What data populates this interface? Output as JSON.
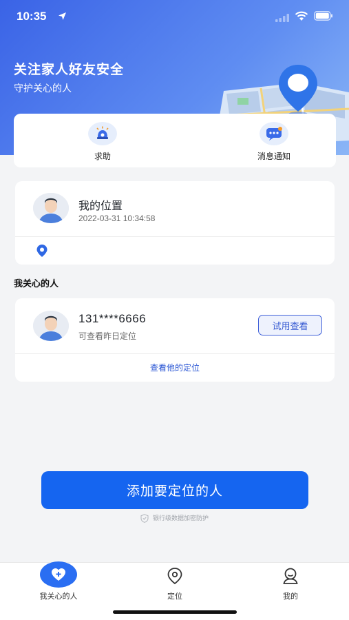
{
  "status_bar": {
    "time": "10:35"
  },
  "hero": {
    "title": "关注家人好友安全",
    "subtitle": "守护关心的人"
  },
  "quick_actions": [
    {
      "label": "求助",
      "icon": "alarm-bell-icon"
    },
    {
      "label": "消息通知",
      "icon": "message-icon"
    }
  ],
  "my_location": {
    "title": "我的位置",
    "timestamp": "2022-03-31 10:34:58",
    "address": ""
  },
  "section_title": "我关心的人",
  "cared_person": {
    "phone": "131****6666",
    "description": "可查看昨日定位",
    "trial_button": "试用查看",
    "view_link": "查看他的定位"
  },
  "primary_button": "添加要定位的人",
  "secure_note": "银行级数据加密防护",
  "tabs": [
    {
      "label": "我关心的人",
      "icon": "heart-plus-icon",
      "active": true
    },
    {
      "label": "定位",
      "icon": "location-icon",
      "active": false
    },
    {
      "label": "我的",
      "icon": "profile-icon",
      "active": false
    }
  ],
  "colors": {
    "primary": "#1565f0",
    "hero_start": "#3a63e6",
    "hero_end": "#8bb6f6"
  }
}
